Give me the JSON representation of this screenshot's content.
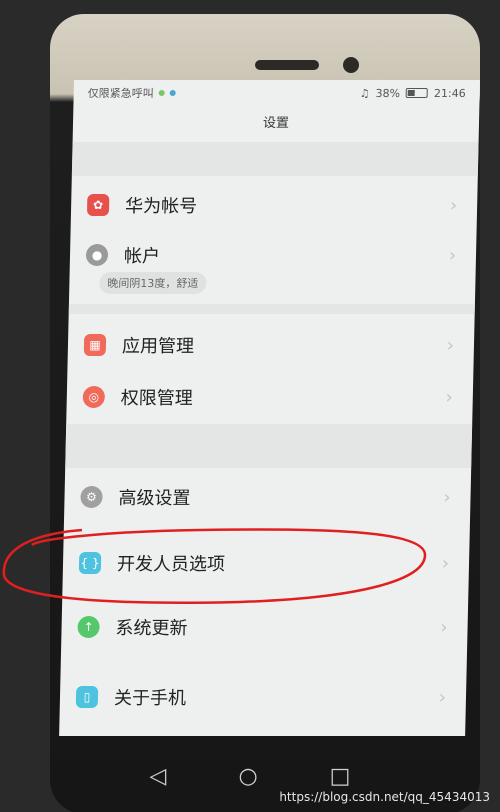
{
  "status_bar": {
    "carrier_text": "仅限紧急呼叫",
    "battery_percent": "38%",
    "time": "21:46"
  },
  "page": {
    "title": "设置"
  },
  "items": [
    {
      "label": "华为帐号",
      "icon": "huawei-logo-icon",
      "color": "#e8504c"
    },
    {
      "label": "帐户",
      "icon": "user-icon",
      "color": "#9a9a9a"
    },
    {
      "label": "应用管理",
      "icon": "apps-grid-icon",
      "color": "#ef6a5a"
    },
    {
      "label": "权限管理",
      "icon": "permission-icon",
      "color": "#ef6a5a"
    },
    {
      "label": "高级设置",
      "icon": "gear-icon",
      "color": "#a0a0a0"
    },
    {
      "label": "开发人员选项",
      "icon": "braces-icon",
      "color": "#4ec3e0"
    },
    {
      "label": "系统更新",
      "icon": "update-arrow-icon",
      "color": "#54c86a"
    },
    {
      "label": "关于手机",
      "icon": "phone-icon",
      "color": "#4ec3e0"
    }
  ],
  "account_hint": "晚间阴13度，舒适",
  "nav": {
    "back": "◁",
    "home": "○",
    "recent": "□"
  },
  "watermark": "https://blog.csdn.net/qq_45434013",
  "annotation_color": "#e02020"
}
